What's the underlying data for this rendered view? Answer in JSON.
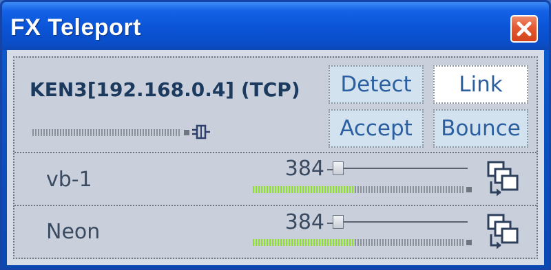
{
  "window": {
    "title": "FX Teleport",
    "close_label": "close"
  },
  "connection": {
    "label": "KEN3[192.168.0.4] (TCP)",
    "meter_level": 0
  },
  "buttons": {
    "detect": "Detect",
    "link": "Link",
    "accept": "Accept",
    "bounce": "Bounce"
  },
  "channels": [
    {
      "name": "vb-1",
      "value": "384",
      "slider_fraction": 0.02,
      "meter_level": 0.48
    },
    {
      "name": "Neon",
      "value": "384",
      "slider_fraction": 0.02,
      "meter_level": 0.48
    }
  ],
  "colors": {
    "title_bar": "#0a55d8",
    "panel": "#c9d0dc",
    "meter_lit": "#8ae020",
    "button_text": "#2c5fa0",
    "close_button": "#e35a32"
  },
  "icons": {
    "close": "close-x-icon",
    "plug": "plug-icon",
    "route": "route-windows-icon"
  }
}
